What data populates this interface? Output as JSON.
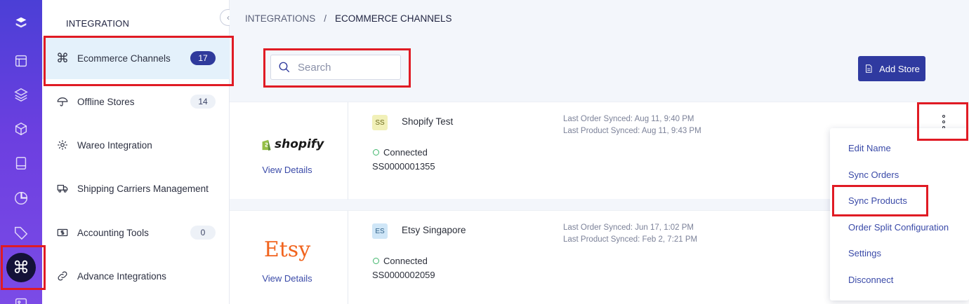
{
  "colors": {
    "accent": "#2f3aa0",
    "rail_top": "#4b3fd6",
    "rail_bottom": "#7b4be6",
    "highlight": "#e01b24",
    "connected": "#3fb66b"
  },
  "rail": {
    "icons": [
      "app-logo-icon",
      "layout-icon",
      "layers-icon",
      "box-icon",
      "book-icon",
      "pie-chart-icon",
      "tag-icon",
      "command-icon",
      "image-icon"
    ],
    "active_glyph": "⌘"
  },
  "sidebar": {
    "title": "INTEGRATION",
    "items": [
      {
        "label": "Ecommerce Channels",
        "count": "17",
        "icon": "command-icon"
      },
      {
        "label": "Offline Stores",
        "count": "14",
        "icon": "umbrella-icon"
      },
      {
        "label": "Wareo Integration",
        "count": "",
        "icon": "gear-icon"
      },
      {
        "label": "Shipping Carriers Management",
        "count": "",
        "icon": "truck-icon"
      },
      {
        "label": "Accounting Tools",
        "count": "0",
        "icon": "dollar-icon"
      },
      {
        "label": "Advance Integrations",
        "count": "",
        "icon": "link-icon"
      }
    ]
  },
  "breadcrumb": {
    "parent": "INTEGRATIONS",
    "separator": "/",
    "current": "ECOMMERCE CHANNELS"
  },
  "search": {
    "placeholder": "Search",
    "value": ""
  },
  "toolbar": {
    "add_store_label": "Add Store"
  },
  "stores": [
    {
      "platform": "shopify",
      "view_details": "View Details",
      "badge": "SS",
      "badge_bg": "#f1f0b8",
      "badge_fg": "#6b6a1c",
      "name": "Shopify Test",
      "status": "Connected",
      "code": "SS0000001355",
      "last_order": "Last Order Synced: Aug 11, 9:40 PM",
      "last_product": "Last Product Synced: Aug 11, 9:43 PM"
    },
    {
      "platform": "Etsy",
      "view_details": "View Details",
      "badge": "ES",
      "badge_bg": "#cfe6f7",
      "badge_fg": "#2d5f86",
      "name": "Etsy Singapore",
      "status": "Connected",
      "code": "SS0000002059",
      "last_order": "Last Order Synced: Jun 17, 1:02 PM",
      "last_product": "Last Product Synced: Feb 2, 7:21 PM"
    }
  ],
  "menu": {
    "items": [
      "Edit Name",
      "Sync Orders",
      "Sync Products",
      "Order Split Configuration",
      "Settings",
      "Disconnect"
    ]
  }
}
